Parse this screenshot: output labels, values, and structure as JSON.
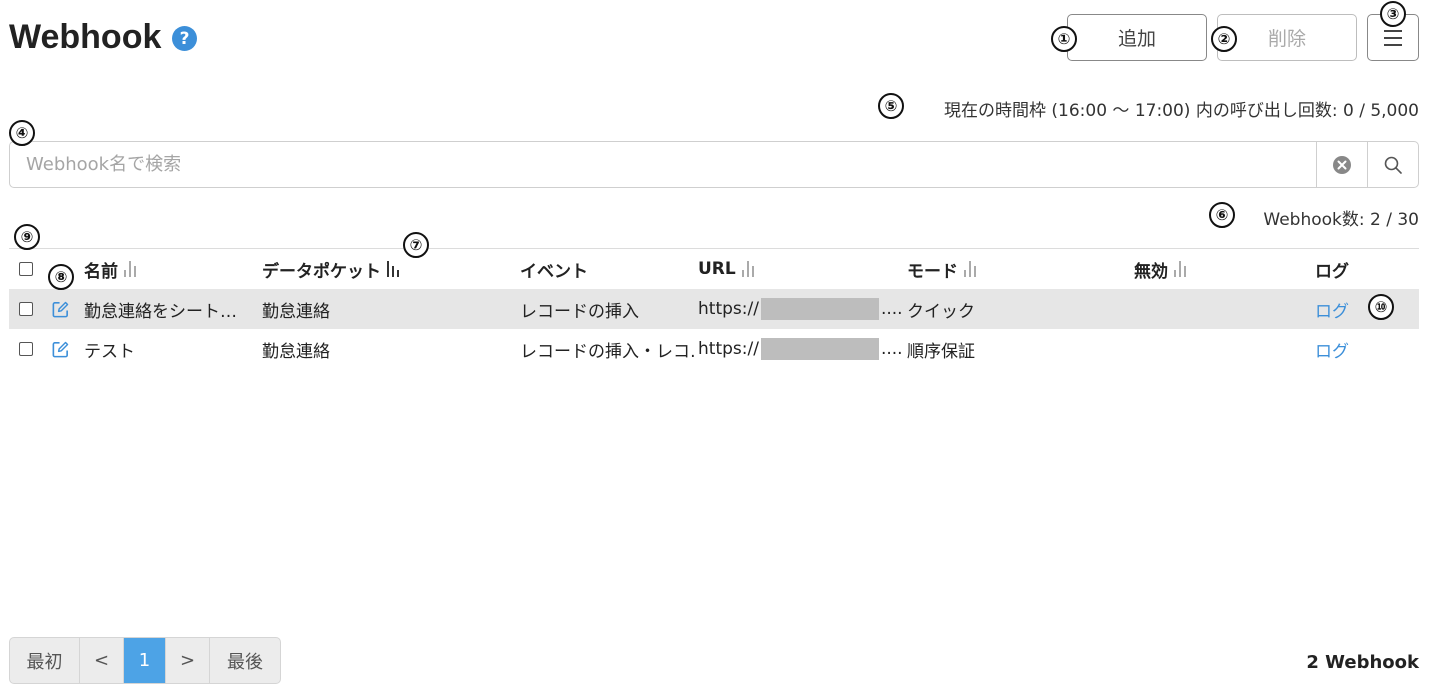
{
  "header": {
    "title": "Webhook",
    "help_icon": "?"
  },
  "toolbar": {
    "add_label": "追加",
    "delete_label": "削除",
    "menu_icon": "hamburger-icon"
  },
  "rate_info": "現在の時間枠 (16:00 〜 17:00) 内の呼び出し回数: 0 / 5,000",
  "search": {
    "placeholder": "Webhook名で検索",
    "value": ""
  },
  "count_info": "Webhook数: 2 / 30",
  "table": {
    "columns": [
      "名前",
      "データポケット",
      "イベント",
      "URL",
      "モード",
      "無効",
      "ログ"
    ],
    "rows": [
      {
        "name": "勤怠連絡をシート…",
        "datapocket": "勤怠連絡",
        "event": "レコードの挿入",
        "url_prefix": "https://",
        "url_suffix": "....",
        "mode": "クイック",
        "disabled": "",
        "log": "ログ"
      },
      {
        "name": "テスト",
        "datapocket": "勤怠連絡",
        "event": "レコードの挿入・レコ…",
        "url_prefix": "https://",
        "url_suffix": "....",
        "mode": "順序保証",
        "disabled": "",
        "log": "ログ"
      }
    ]
  },
  "pagination": {
    "first": "最初",
    "prev": "<",
    "current": "1",
    "next": ">",
    "last": "最後"
  },
  "total": "2 Webhook",
  "markers": [
    "①",
    "②",
    "③",
    "④",
    "⑤",
    "⑥",
    "⑦",
    "⑧",
    "⑨",
    "⑩"
  ],
  "colors": {
    "accent": "#3c8fd9",
    "page_active": "#4da3e6",
    "row_highlight": "#e6e6e6"
  }
}
